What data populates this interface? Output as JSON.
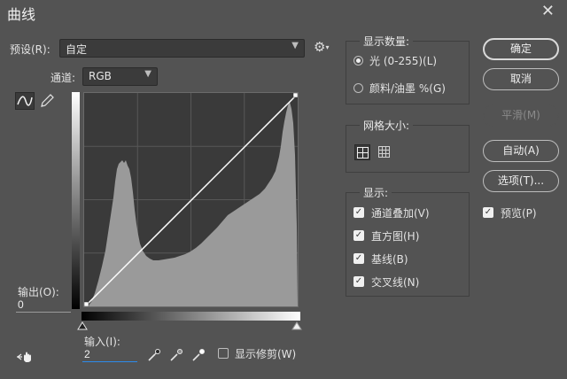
{
  "window": {
    "title": "曲线",
    "close_glyph": "✕"
  },
  "preset": {
    "label": "预设(R):",
    "value": "自定",
    "settings_glyph": "⚙"
  },
  "channel": {
    "label": "通道:",
    "value": "RGB"
  },
  "output": {
    "label": "输出(O):",
    "value": "0"
  },
  "input": {
    "label": "输入(I):",
    "value": "2"
  },
  "show_clipping": {
    "label": "显示修剪(W)",
    "checked": false
  },
  "display_amount": {
    "title": "显示数量:",
    "options": [
      {
        "label": "光 (0-255)(L)",
        "selected": true
      },
      {
        "label": "颜料/油墨 %(G)",
        "selected": false
      }
    ]
  },
  "grid_size": {
    "title": "网格大小:",
    "options": [
      "coarse-grid-icon",
      "fine-grid-icon"
    ],
    "selected": "coarse-grid-icon"
  },
  "show": {
    "title": "显示:",
    "items": [
      {
        "label": "通道叠加(V)",
        "checked": true
      },
      {
        "label": "直方图(H)",
        "checked": true
      },
      {
        "label": "基线(B)",
        "checked": true
      },
      {
        "label": "交叉线(N)",
        "checked": true
      }
    ]
  },
  "buttons": {
    "ok": "确定",
    "cancel": "取消",
    "smooth": "平滑(M)",
    "auto": "自动(A)",
    "options": "选项(T)..."
  },
  "preview": {
    "label": "预览(P)",
    "checked": true
  },
  "colors": {
    "dialog_bg": "#535353",
    "grid_bg": "#3a3a3a",
    "histogram": "#9a9a9a"
  }
}
